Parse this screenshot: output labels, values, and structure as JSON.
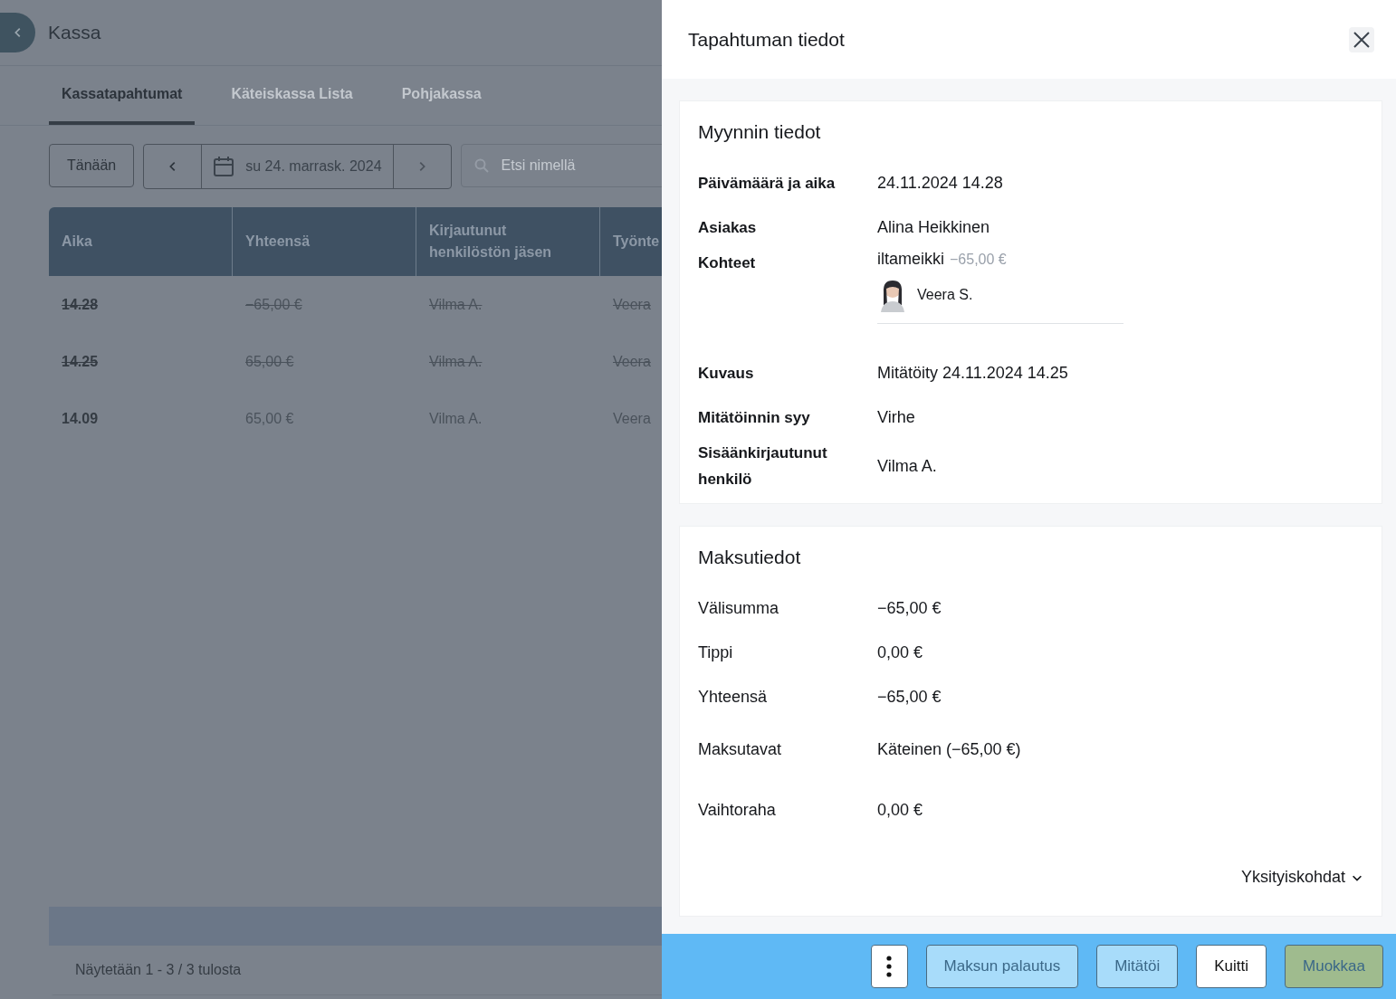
{
  "header": {
    "title": "Kassa"
  },
  "tabs": [
    {
      "label": "Kassatapahtumat",
      "selected": true
    },
    {
      "label": "Käteiskassa Lista",
      "selected": false
    },
    {
      "label": "Pohjakassa",
      "selected": false
    }
  ],
  "toolbar": {
    "today_button": "Tänään",
    "date": "su 24. marrask. 2024",
    "search": {
      "placeholder": "Etsi nimellä"
    }
  },
  "table": {
    "columns": [
      "Aika",
      "Yhteensä",
      "Kirjautunut henkilöstön jäsen",
      "Työnte"
    ],
    "rows": [
      {
        "cells": [
          "14.28",
          "−65,00 €",
          "Vilma A.",
          "Veera"
        ],
        "voided": true
      },
      {
        "cells": [
          "14.25",
          "65,00 €",
          "Vilma A.",
          "Veera"
        ],
        "voided": true
      },
      {
        "cells": [
          "14.09",
          "65,00 €",
          "Vilma A.",
          "Veera"
        ],
        "voided": false
      }
    ]
  },
  "pagination": "Näytetään 1 - 3 / 3 tulosta",
  "panel": {
    "title": "Tapahtuman tiedot",
    "sections": [
      {
        "title": "Myynnin tiedot",
        "rows": [
          {
            "kind": "detail",
            "label": "Päivämäärä ja aika",
            "value": "24.11.2024 14.28"
          },
          {
            "kind": "detail",
            "label": "Asiakas",
            "value": "Alina Heikkinen"
          },
          {
            "kind": "items",
            "label": "Kohteet",
            "items": [
              {
                "name": "iltameikki",
                "price": "−65,00 €",
                "staff": "Veera S."
              }
            ]
          },
          {
            "kind": "detail",
            "label": "Kuvaus",
            "value": "Mitätöity 24.11.2024 14.25"
          },
          {
            "kind": "detail",
            "label": "Mitätöinnin syy",
            "value": "Virhe"
          },
          {
            "kind": "detail",
            "label": "Sisäänkirjautunut henkilö",
            "value": "Vilma A."
          }
        ]
      },
      {
        "title": "Maksutiedot",
        "rows": [
          {
            "kind": "text",
            "label": "Välisumma",
            "value": "−65,00 €"
          },
          {
            "kind": "text",
            "label": "Tippi",
            "value": "0,00 €"
          },
          {
            "kind": "text",
            "label": "Yhteensä",
            "value": "−65,00 €"
          },
          {
            "kind": "spaced",
            "label": "Maksutavat",
            "value": "Käteinen (−65,00 €)"
          },
          {
            "kind": "spaced",
            "label": "Vaihtoraha",
            "value": "0,00 €"
          }
        ],
        "details_toggle": "Yksityiskohdat"
      }
    ]
  },
  "actions": [
    {
      "kind": "more"
    },
    {
      "kind": "light",
      "label": "Maksun palautus"
    },
    {
      "kind": "light",
      "label": "Mitätöi"
    },
    {
      "kind": "white",
      "label": "Kuitti"
    },
    {
      "kind": "green",
      "label": "Muokkaa"
    }
  ]
}
